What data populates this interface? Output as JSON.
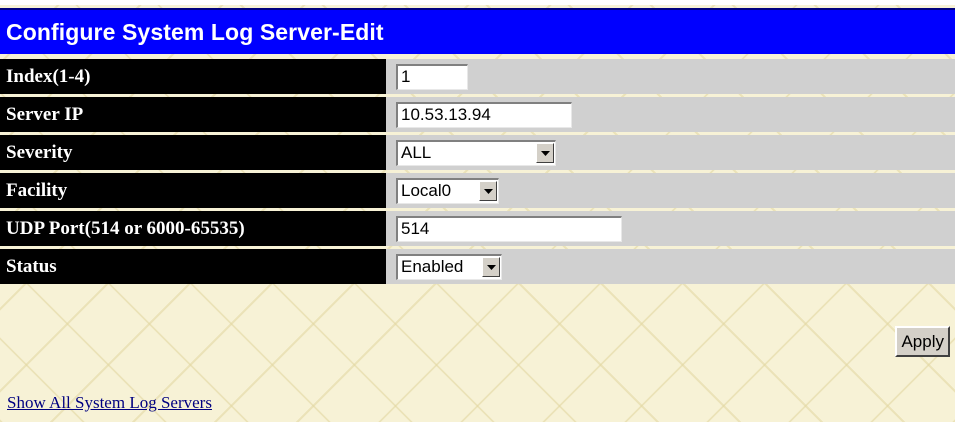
{
  "title": "Configure System Log Server-Edit",
  "fields": [
    {
      "label": "Index(1-4)",
      "value": "1"
    },
    {
      "label": "Server IP",
      "value": "10.53.13.94"
    },
    {
      "label": "Severity",
      "value": "ALL"
    },
    {
      "label": "Facility",
      "value": "Local0"
    },
    {
      "label": "UDP Port(514 or 6000-65535)",
      "value": "514"
    },
    {
      "label": "Status",
      "value": "Enabled"
    }
  ],
  "apply_label": "Apply",
  "link_label": "Show All System Log Servers",
  "colors": {
    "title_bar": "#0000ff",
    "label_bg": "#000000",
    "value_bg": "#d0d0d0",
    "link": "#000080"
  }
}
